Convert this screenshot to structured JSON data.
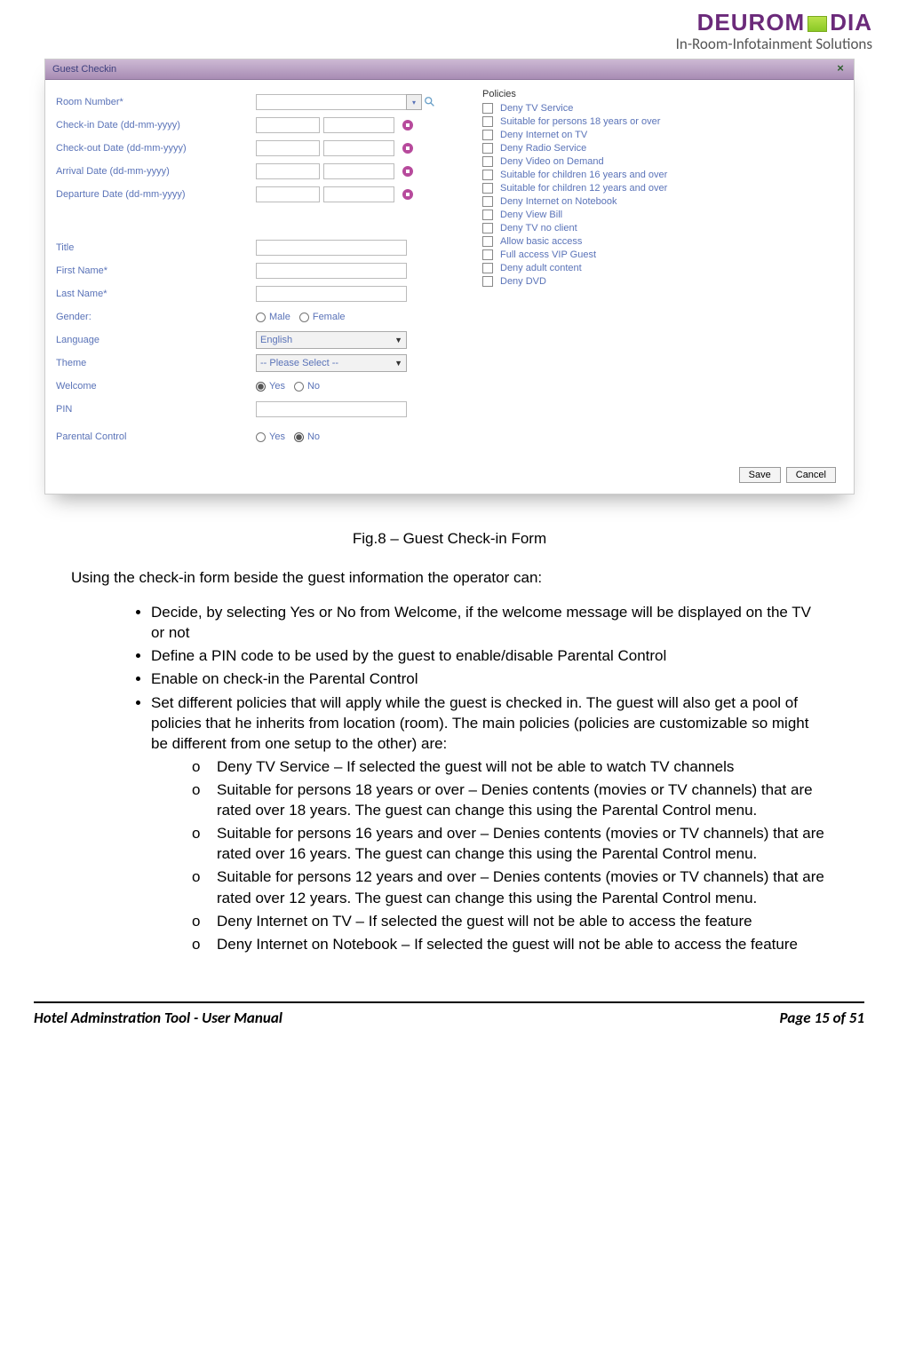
{
  "logo": {
    "brand_pre": "DEUROM",
    "brand_post": "DIA",
    "tagline": "In-Room-Infotainment Solutions"
  },
  "shot": {
    "title": "Guest Checkin",
    "labels": {
      "room": "Room Number*",
      "checkin": "Check-in Date (dd-mm-yyyy)",
      "checkout": "Check-out Date (dd-mm-yyyy)",
      "arrival": "Arrival Date (dd-mm-yyyy)",
      "departure": "Departure Date (dd-mm-yyyy)",
      "title": "Title",
      "first": "First Name*",
      "last": "Last Name*",
      "gender": "Gender:",
      "language": "Language",
      "theme": "Theme",
      "welcome": "Welcome",
      "pin": "PIN",
      "parental": "Parental Control"
    },
    "gender_opts": {
      "male": "Male",
      "female": "Female"
    },
    "yesno": {
      "yes": "Yes",
      "no": "No"
    },
    "language_value": "English",
    "theme_value": "-- Please Select --",
    "policies_title": "Policies",
    "policies": [
      "Deny TV Service",
      "Suitable for persons 18 years or over",
      "Deny Internet on TV",
      "Deny Radio Service",
      "Deny Video on Demand",
      "Suitable for children 16 years and over",
      "Suitable for children 12 years and over",
      "Deny Internet on Notebook",
      "Deny View Bill",
      "Deny TV no client",
      "Allow basic access",
      "Full access VIP Guest",
      "Deny adult content",
      "Deny DVD"
    ],
    "save": "Save",
    "cancel": "Cancel"
  },
  "caption": "Fig.8 – Guest Check-in Form",
  "doc": {
    "intro": "Using the check-in form beside the guest information the operator can:",
    "bullets": [
      "Decide, by selecting Yes or No from Welcome, if the welcome message will be displayed on the TV or not",
      "Define a PIN code to be used by the guest to enable/disable Parental Control",
      "Enable on check-in the Parental Control",
      "Set different policies that will apply while the guest is checked in. The guest will also get a pool of policies that he inherits from location (room). The main policies (policies are customizable so might be different from one setup to the other) are:"
    ],
    "sub": [
      "Deny TV Service – If selected the guest will not be able to watch TV channels",
      "Suitable for persons 18 years or over – Denies contents (movies or TV channels) that are rated over 18 years. The guest can change this using the Parental Control menu.",
      "Suitable for persons 16 years and over – Denies contents (movies or TV channels) that are rated over 16 years. The guest can change this using the Parental Control menu.",
      "Suitable for persons 12 years and over – Denies contents (movies or TV channels) that are rated over 12 years. The guest can change this using the Parental Control menu.",
      "Deny Internet on TV – If selected the guest will not be able to access the feature",
      "Deny Internet on Notebook – If selected the guest will not be able to access the feature"
    ]
  },
  "footer": {
    "left": "Hotel Adminstration Tool - User Manual",
    "right": "Page 15 of 51"
  }
}
